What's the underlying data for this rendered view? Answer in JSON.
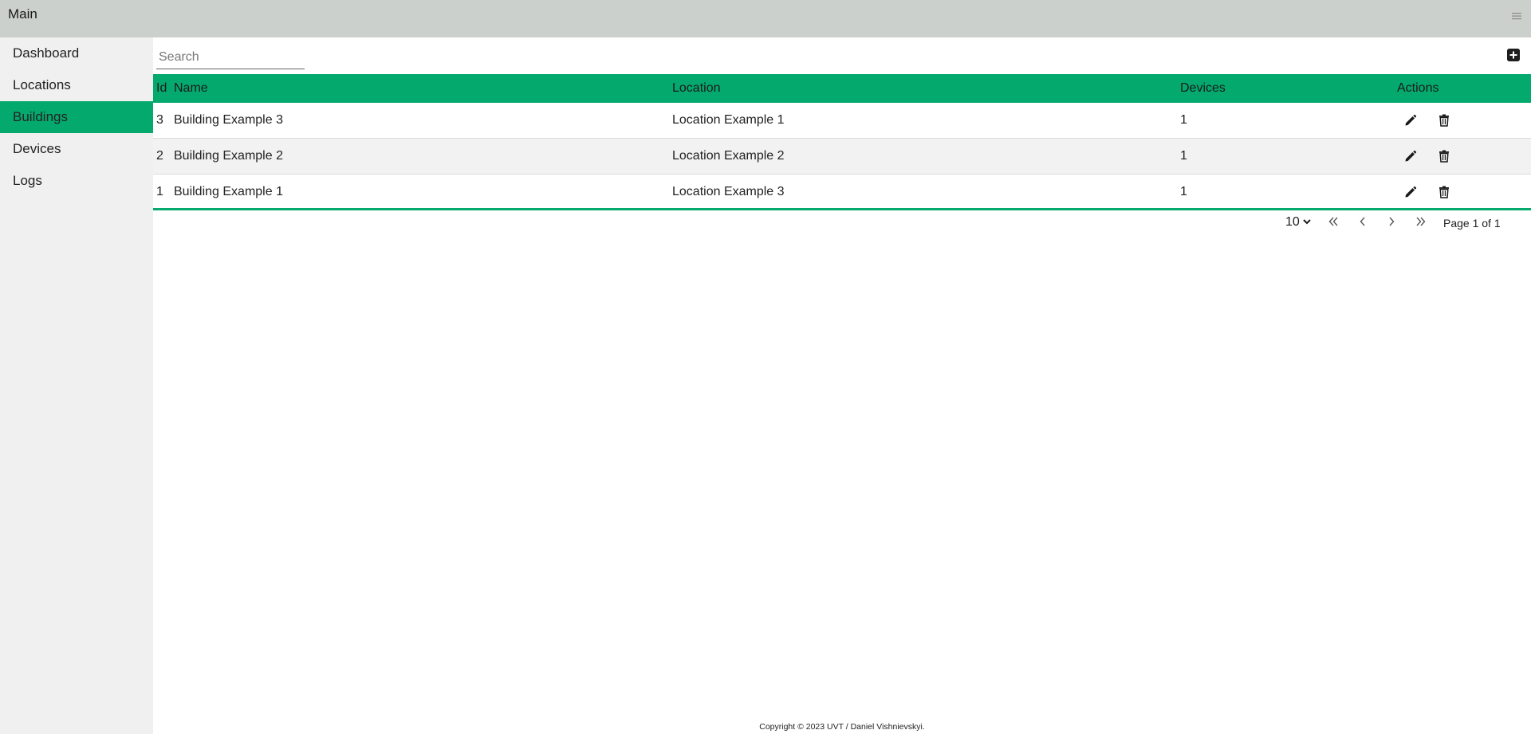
{
  "header": {
    "title": "Main",
    "menu_icon": "hamburger-menu-icon"
  },
  "sidebar": {
    "items": [
      {
        "label": "Dashboard",
        "active": false
      },
      {
        "label": "Locations",
        "active": false
      },
      {
        "label": "Buildings",
        "active": true
      },
      {
        "label": "Devices",
        "active": false
      },
      {
        "label": "Logs",
        "active": false
      }
    ]
  },
  "toolbar": {
    "search_placeholder": "Search",
    "search_value": "",
    "add_icon": "plus-square-icon"
  },
  "table": {
    "columns": {
      "id": "Id",
      "name": "Name",
      "location": "Location",
      "devices": "Devices",
      "actions": "Actions"
    },
    "rows": [
      {
        "id": "3",
        "name": "Building Example 3",
        "location": "Location Example 1",
        "devices": "1"
      },
      {
        "id": "2",
        "name": "Building Example 2",
        "location": "Location Example 2",
        "devices": "1"
      },
      {
        "id": "1",
        "name": "Building Example 1",
        "location": "Location Example 3",
        "devices": "1"
      }
    ]
  },
  "pagination": {
    "page_size": "10",
    "page_info": "Page 1 of 1"
  },
  "footer": {
    "text": "Copyright © 2023 UVT / Daniel Vishnievskyi."
  },
  "colors": {
    "accent": "#04aa6d",
    "topbar": "#ccd0cc",
    "sidebar": "#f0f0f0",
    "row_alt": "#f2f2f2"
  }
}
